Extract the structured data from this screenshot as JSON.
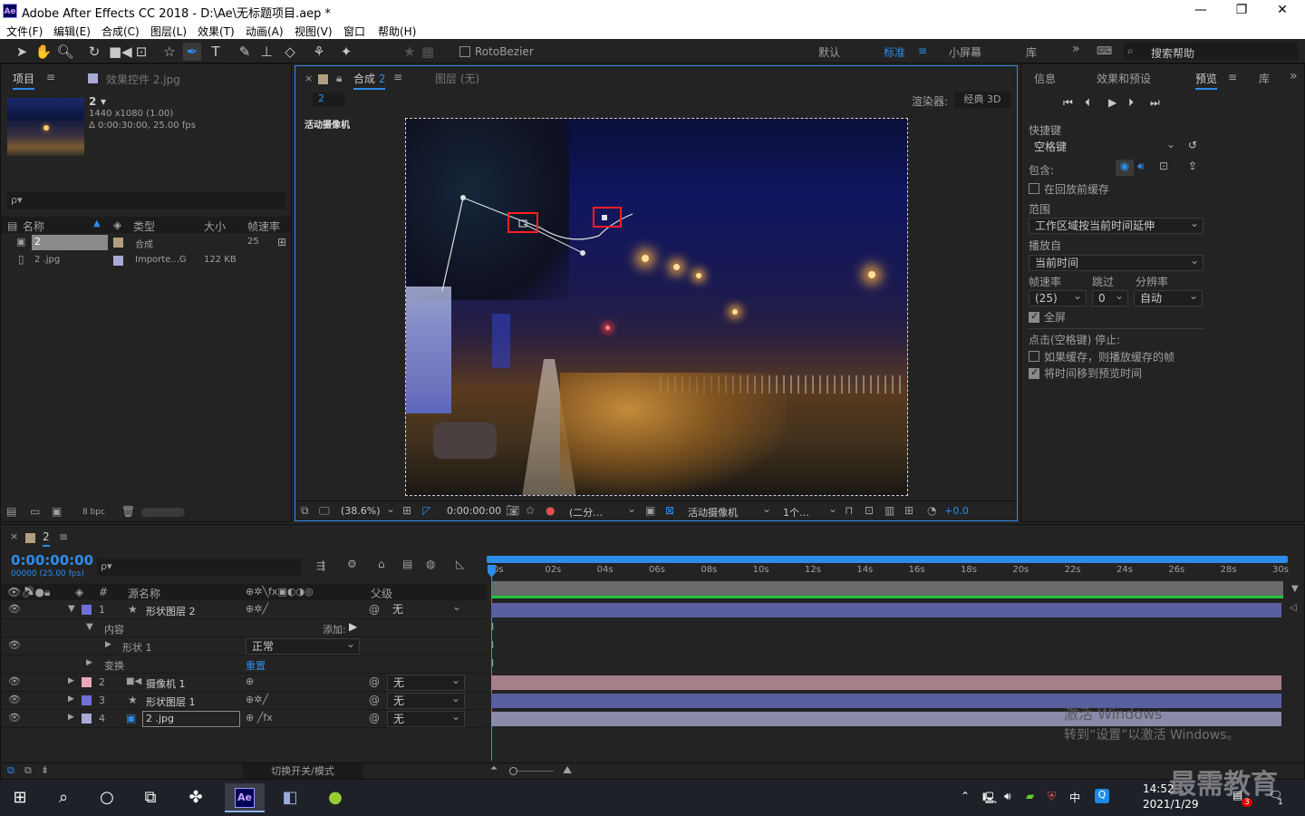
{
  "titlebar": {
    "title": "Adobe After Effects CC 2018 - D:\\Ae\\无标题项目.aep *",
    "logo": "Ae",
    "min": "—",
    "max": "❐",
    "close": "✕"
  },
  "menu": [
    "文件(F)",
    "编辑(E)",
    "合成(C)",
    "图层(L)",
    "效果(T)",
    "动画(A)",
    "视图(V)",
    "窗口",
    "帮助(H)"
  ],
  "toolbar": {
    "rotobezier": "RotoBezier",
    "workspaces": [
      "默认",
      "标准",
      "小屏幕",
      "库"
    ],
    "active_workspace": "标准",
    "search": "搜索帮助",
    "more": "»"
  },
  "project": {
    "tab": "项目",
    "tab2": "效果控件 2.jpg",
    "item_name": "2",
    "item_arrow": "▾",
    "item_res": "1440 x1080 (1.00)",
    "item_dur": "Δ 0:00:30:00, 25.00 fps",
    "search_icon": "ρ▾",
    "col_name": "名称",
    "col_type": "类型",
    "col_size": "大小",
    "col_fps": "帧速率",
    "items": [
      {
        "name": "2",
        "type": "合成",
        "size": "",
        "fps": "25",
        "color": "#b29f80"
      },
      {
        "name": "2 .jpg",
        "type": "Importe...G",
        "size": "122 KB",
        "fps": "",
        "color": "#a9a9d6"
      }
    ],
    "bpc": "8 bpc"
  },
  "viewer": {
    "close": "×",
    "tab": "合成",
    "tab_num": "2",
    "tab2": "图层 (无)",
    "comp_chip": "2",
    "renderer_label": "渲染器:",
    "renderer": "经典 3D",
    "camera_label": "活动摄像机",
    "zoom": "(38.6%)",
    "timecode": "0:00:00:00",
    "res": "(二分…",
    "view": "活动摄像机",
    "views": "1个…",
    "exposure": "+0.0"
  },
  "preview": {
    "tabs": [
      "信息",
      "效果和预设",
      "预览",
      "库"
    ],
    "active": "预览",
    "shortcut_label": "快捷键",
    "shortcut": "空格键",
    "include_label": "包含:",
    "cache_before": "在回放前缓存",
    "range_label": "范围",
    "range": "工作区域按当前时间延伸",
    "play_from_label": "播放自",
    "play_from": "当前时间",
    "fps_label": "帧速率",
    "skip_label": "跳过",
    "res_label": "分辨率",
    "fps": "(25)",
    "skip": "0",
    "res": "自动",
    "fullscreen": "全屏",
    "stop_label": "点击(空格键) 停止:",
    "if_cached": "如果缓存，则播放缓存的帧",
    "move_time": "将时间移到预览时间"
  },
  "timeline": {
    "tab": "2",
    "timecode": "0:00:00:00",
    "frames": "00000 (25.00 fps)",
    "col_num": "#",
    "col_src": "源名称",
    "col_parent": "父级",
    "ticks": [
      "0s",
      "02s",
      "04s",
      "06s",
      "08s",
      "10s",
      "12s",
      "14s",
      "16s",
      "18s",
      "20s",
      "22s",
      "24s",
      "26s",
      "28s",
      "30s"
    ],
    "layers": [
      {
        "num": "1",
        "name": "形状图层 2",
        "icon": "★",
        "color": "#7070d8",
        "parent": "无",
        "bar": "#5a5fa0"
      },
      {
        "num": "2",
        "name": "摄像机 1",
        "icon": "■◀",
        "color": "#e8a8b8",
        "parent": "无",
        "bar": "#a68088"
      },
      {
        "num": "3",
        "name": "形状图层 1",
        "icon": "★",
        "color": "#7070d8",
        "parent": "无",
        "bar": "#5a5fa0"
      },
      {
        "num": "4",
        "name": "2 .jpg",
        "icon": "▣",
        "color": "#a9a9d6",
        "parent": "无",
        "bar": "#8a8aaa"
      }
    ],
    "content_label": "内容",
    "add_label": "添加:",
    "shape_label": "形状 1",
    "blend": "正常",
    "transform_label": "变换",
    "reset": "重置",
    "toggle_modes": "切换开关/模式"
  },
  "watermark": {
    "line1": "激活 Windows",
    "line2": "转到“设置”以激活 Windows。",
    "brand": "最需教育"
  },
  "taskbar": {
    "time": "14:52",
    "date": "2021/1/29",
    "ime": "中",
    "notif": "3",
    "notif2": "1"
  }
}
